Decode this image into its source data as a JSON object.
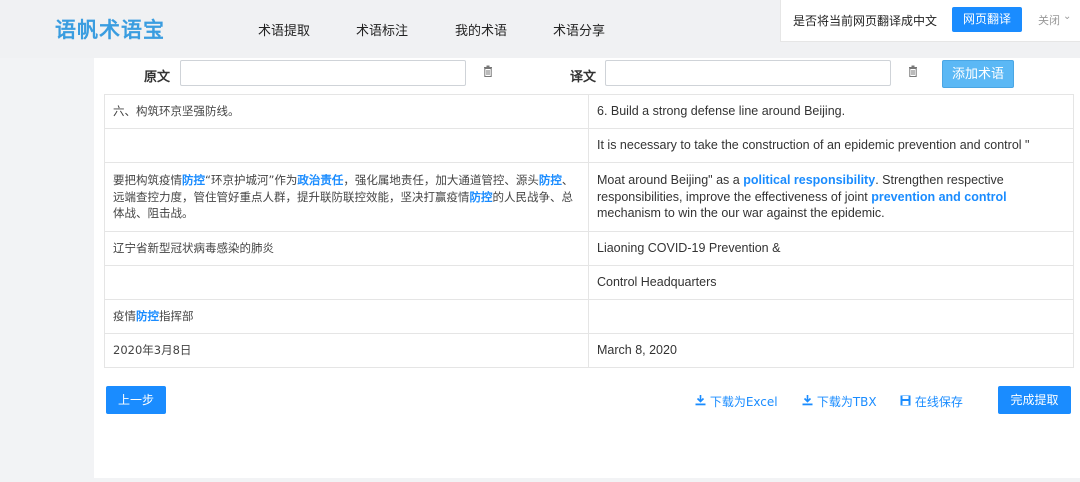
{
  "app": {
    "logo": "语帆术语宝"
  },
  "nav": {
    "items": [
      "术语提取",
      "术语标注",
      "我的术语",
      "术语分享"
    ]
  },
  "translate_bar": {
    "question": "是否将当前网页翻译成中文",
    "button": "网页翻译",
    "close": "关闭"
  },
  "form": {
    "source_label": "原文",
    "source_value": "",
    "target_label": "译文",
    "target_value": "",
    "add_button": "添加术语"
  },
  "rows": [
    {
      "zh": [
        {
          "t": "六、构筑环京坚强防线。"
        }
      ],
      "en": [
        {
          "t": "6. Build a strong defense line around Beijing."
        }
      ]
    },
    {
      "zh": [],
      "en": [
        {
          "t": "It is necessary to take the construction of an epidemic prevention and control \""
        }
      ]
    },
    {
      "zh": [
        {
          "t": "要把构筑疫情"
        },
        {
          "t": "防控",
          "hl": true
        },
        {
          "t": "“环京护城河”作为"
        },
        {
          "t": "政治责任",
          "hl": true
        },
        {
          "t": "，强化属地责任，加大通道管控、源头"
        },
        {
          "t": "防控",
          "hl": true
        },
        {
          "t": "、远端查控力度，管住管好重点人群，提升联防联控效能，坚决打赢疫情"
        },
        {
          "t": "防控",
          "hl": true
        },
        {
          "t": "的人民战争、总体战、阻击战。"
        }
      ],
      "en": [
        {
          "t": "Moat around Beijing\" as a "
        },
        {
          "t": "political responsibility",
          "hl": true
        },
        {
          "t": ". Strengthen respective responsibilities, improve the effectiveness of joint "
        },
        {
          "t": "prevention and control",
          "hl": true
        },
        {
          "t": " mechanism to win the our war against the epidemic."
        }
      ]
    },
    {
      "zh": [
        {
          "t": "辽宁省新型冠状病毒感染的肺炎"
        }
      ],
      "en": [
        {
          "t": "Liaoning COVID-19 Prevention &"
        }
      ]
    },
    {
      "zh": [],
      "en": [
        {
          "t": "Control Headquarters"
        }
      ]
    },
    {
      "zh": [
        {
          "t": "疫情"
        },
        {
          "t": "防控",
          "hl": true
        },
        {
          "t": "指挥部"
        }
      ],
      "en": []
    },
    {
      "zh": [
        {
          "t": "2020年3月8日"
        }
      ],
      "en": [
        {
          "t": "March 8, 2020"
        }
      ]
    }
  ],
  "footer": {
    "back": "上一步",
    "download_excel": "下载为Excel",
    "download_tbx": "下载为TBX",
    "save_online": "在线保存",
    "done": "完成提取"
  },
  "colors": {
    "accent": "#1a8cff",
    "logo": "#3a9de0"
  },
  "icons": {
    "trash": "trash-icon",
    "download": "download-icon",
    "save": "save-icon",
    "chevron": "chevron-down-icon"
  }
}
